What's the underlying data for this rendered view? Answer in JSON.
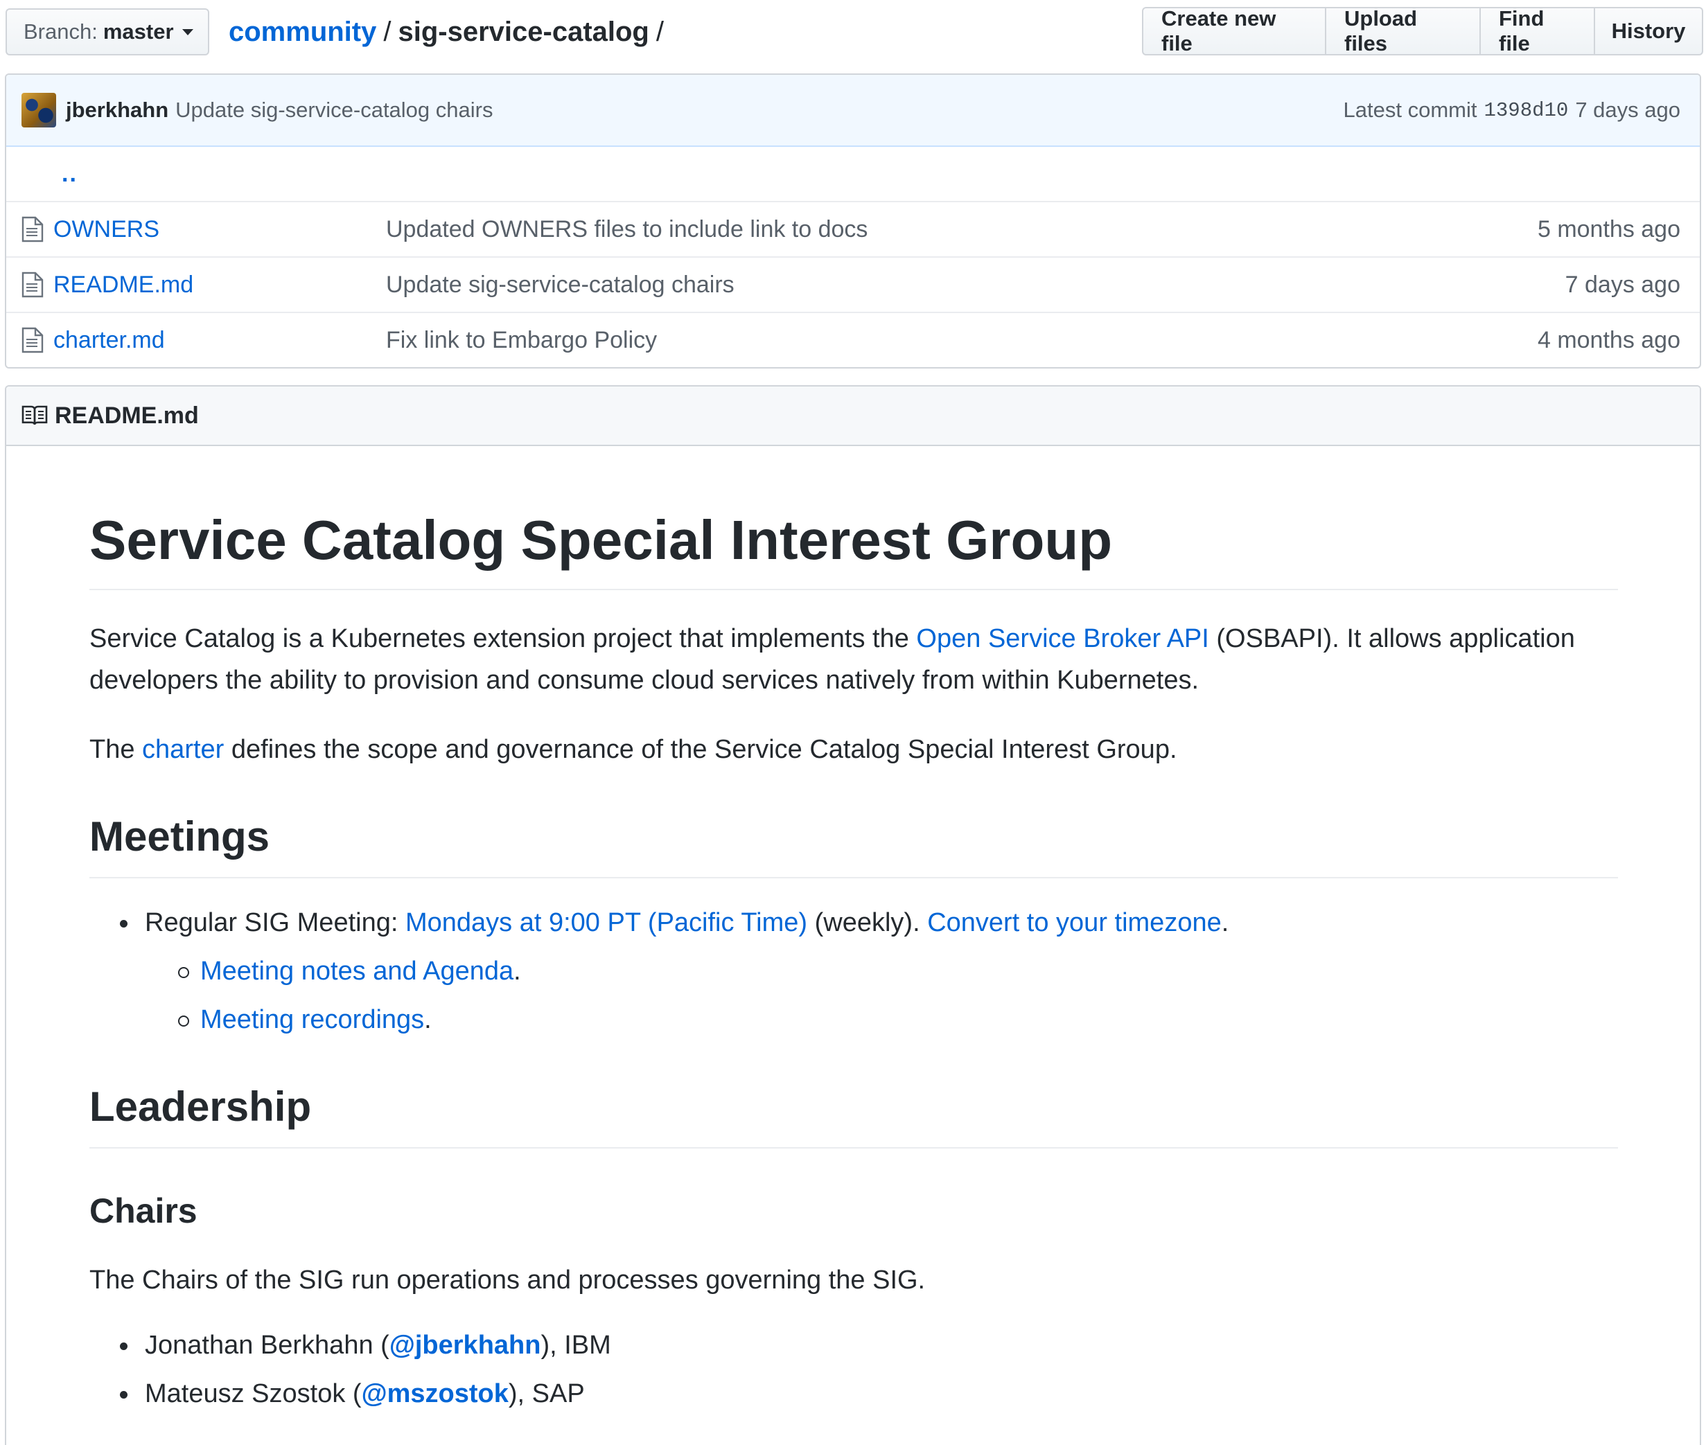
{
  "branch": {
    "prefix": "Branch:",
    "value": "master"
  },
  "breadcrumb": {
    "repo": "community",
    "sep1": "/",
    "dir": "sig-service-catalog",
    "sep2": "/"
  },
  "actions": {
    "create": "Create new file",
    "upload": "Upload files",
    "find": "Find file",
    "history": "History"
  },
  "commit": {
    "author": "jberkhahn",
    "message": "Update sig-service-catalog chairs",
    "label": "Latest commit",
    "sha": "1398d10",
    "age": "7 days ago"
  },
  "files": {
    "parent": "..",
    "rows": [
      {
        "name": "OWNERS",
        "message": "Updated OWNERS files to include link to docs",
        "age": "5 months ago"
      },
      {
        "name": "README.md",
        "message": "Update sig-service-catalog chairs",
        "age": "7 days ago"
      },
      {
        "name": "charter.md",
        "message": "Fix link to Embargo Policy",
        "age": "4 months ago"
      }
    ]
  },
  "readme": {
    "filename": "README.md",
    "title": "Service Catalog Special Interest Group",
    "intro": {
      "before": "Service Catalog is a Kubernetes extension project that implements the ",
      "link": "Open Service Broker API",
      "after": " (OSBAPI). It allows application developers the ability to provision and consume cloud services natively from within Kubernetes."
    },
    "charter": {
      "before": "The ",
      "link": "charter",
      "after": " defines the scope and governance of the Service Catalog Special Interest Group."
    },
    "meetings": {
      "heading": "Meetings",
      "regular_prefix": "Regular SIG Meeting: ",
      "regular_link": "Mondays at 9:00 PT (Pacific Time)",
      "regular_mid": " (weekly). ",
      "tz_link": "Convert to your timezone",
      "tz_after": ".",
      "notes_link": "Meeting notes and Agenda",
      "notes_after": ".",
      "recordings_link": "Meeting recordings",
      "recordings_after": "."
    },
    "leadership": {
      "heading": "Leadership",
      "chairs_heading": "Chairs",
      "chairs_desc": "The Chairs of the SIG run operations and processes governing the SIG.",
      "chairs": [
        {
          "name": "Jonathan Berkhahn (",
          "handle": "@jberkhahn",
          "org": "), IBM"
        },
        {
          "name": "Mateusz Szostok (",
          "handle": "@mszostok",
          "org": "), SAP"
        }
      ]
    }
  }
}
